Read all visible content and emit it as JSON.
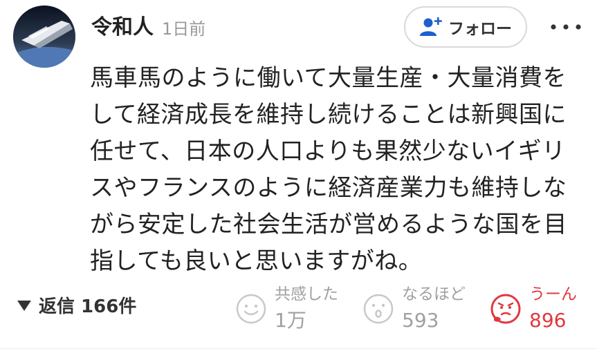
{
  "user": {
    "name": "令和人",
    "posted": "1日前"
  },
  "follow": {
    "label": "フォロー",
    "icon": "add-user-icon"
  },
  "more": {
    "icon": "more-dots-icon"
  },
  "comment": {
    "text": "馬車馬のように働いて大量生産・大量消費を\nして経済成長を維持し続けることは新興国に\n任せて、日本の人口よりも果然少ないイギリ\nスやフランスのように経済産業力も維持しな\nがら安定した社会生活が営めるような国を目\n指しても良いと思いますがね。"
  },
  "replies": {
    "label": "返信 166件",
    "icon": "triangle-down-icon"
  },
  "reactions": [
    {
      "label": "共感した",
      "count": "1万",
      "icon": "smile-face-icon",
      "active": false
    },
    {
      "label": "なるほど",
      "count": "593",
      "icon": "surprised-face-icon",
      "active": false
    },
    {
      "label": "うーん",
      "count": "896",
      "icon": "hmm-face-icon",
      "active": true
    }
  ],
  "colors": {
    "text": "#222222",
    "muted": "#a0a0a0",
    "accent_red": "#e0383e",
    "follow_icon": "#1f5fcf",
    "border": "#d9d9d9"
  }
}
